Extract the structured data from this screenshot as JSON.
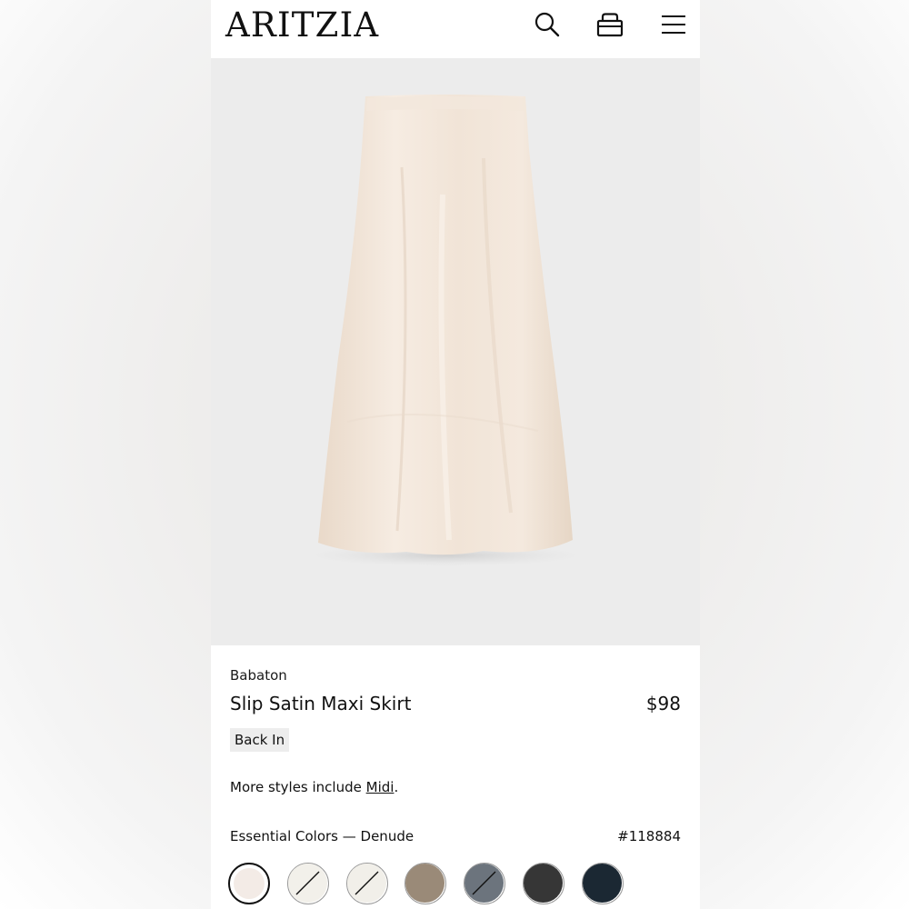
{
  "header": {
    "logo": "ARITZIA",
    "icons": [
      "search-icon",
      "bag-icon",
      "menu-icon"
    ]
  },
  "product": {
    "brand": "Babaton",
    "name": "Slip Satin Maxi Skirt",
    "price": "$98",
    "badge": "Back In",
    "more_styles_prefix": "More styles include ",
    "more_styles_link": "Midi",
    "more_styles_suffix": ".",
    "colors_label": "Essential Colors — Denude",
    "sku": "#118884",
    "swatches": [
      {
        "color": "#f3ebe6",
        "selected": true,
        "unavailable": false
      },
      {
        "color": "#f2f0ea",
        "selected": false,
        "unavailable": true
      },
      {
        "color": "#f1efe9",
        "selected": false,
        "unavailable": true
      },
      {
        "color": "#9a8a78",
        "selected": false,
        "unavailable": false
      },
      {
        "color": "#6c747d",
        "selected": false,
        "unavailable": true
      },
      {
        "color": "#363636",
        "selected": false,
        "unavailable": false
      },
      {
        "color": "#1b2833",
        "selected": false,
        "unavailable": false
      }
    ]
  },
  "colors": {
    "text": "#111111",
    "hero_bg": "#ececec",
    "skirt": "#f0e3d6"
  }
}
